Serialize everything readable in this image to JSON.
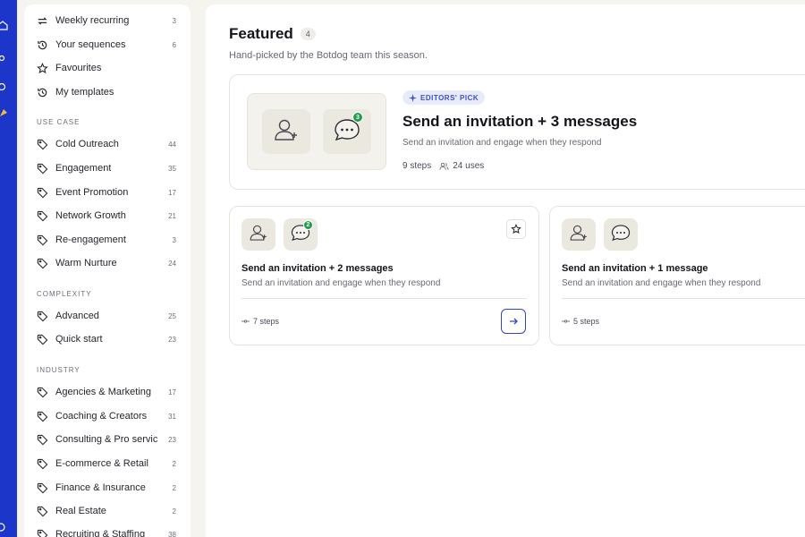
{
  "sidebar": {
    "top_items": [
      {
        "label": "Weekly recurring",
        "count": "3",
        "icon": "repeat-icon"
      },
      {
        "label": "Your sequences",
        "count": "6",
        "icon": "history-icon"
      },
      {
        "label": "Favourites",
        "count": "",
        "icon": "star-icon"
      },
      {
        "label": "My templates",
        "count": "",
        "icon": "history-icon"
      }
    ],
    "use_case_heading": "USE CASE",
    "use_case": [
      {
        "label": "Cold Outreach",
        "count": "44"
      },
      {
        "label": "Engagement",
        "count": "35"
      },
      {
        "label": "Event Promotion",
        "count": "17"
      },
      {
        "label": "Network Growth",
        "count": "21"
      },
      {
        "label": "Re-engagement",
        "count": "3"
      },
      {
        "label": "Warm Nurture",
        "count": "24"
      }
    ],
    "complexity_heading": "COMPLEXITY",
    "complexity": [
      {
        "label": "Advanced",
        "count": "25"
      },
      {
        "label": "Quick start",
        "count": "23"
      }
    ],
    "industry_heading": "INDUSTRY",
    "industry": [
      {
        "label": "Agencies & Marketing",
        "count": "17"
      },
      {
        "label": "Coaching & Creators",
        "count": "31"
      },
      {
        "label": "Consulting & Pro servic",
        "count": "23"
      },
      {
        "label": "E-commerce & Retail",
        "count": "2"
      },
      {
        "label": "Finance & Insurance",
        "count": "2"
      },
      {
        "label": "Real Estate",
        "count": "2"
      },
      {
        "label": "Recruiting & Staffing",
        "count": "38"
      }
    ]
  },
  "featured": {
    "title": "Featured",
    "count": "4",
    "subtitle": "Hand-picked by the Botdog team this season."
  },
  "hero": {
    "badge": "EDITORS' PICK",
    "title": "Send an invitation + 3 messages",
    "description": "Send an invitation and engage when they respond",
    "steps": "9 steps",
    "uses": "24 uses",
    "message_badge": "3"
  },
  "cards": [
    {
      "title": "Send an invitation + 2 messages",
      "description": "Send an invitation and engage when they respond",
      "steps": "7 steps",
      "message_badge": "2"
    },
    {
      "title": "Send an invitation + 1 message",
      "description": "Send an invitation and engage when they respond",
      "steps": "5 steps"
    }
  ],
  "colors": {
    "rail": "#1b36c9",
    "accent": "#3245c2",
    "badge_green": "#1f9d4a"
  }
}
